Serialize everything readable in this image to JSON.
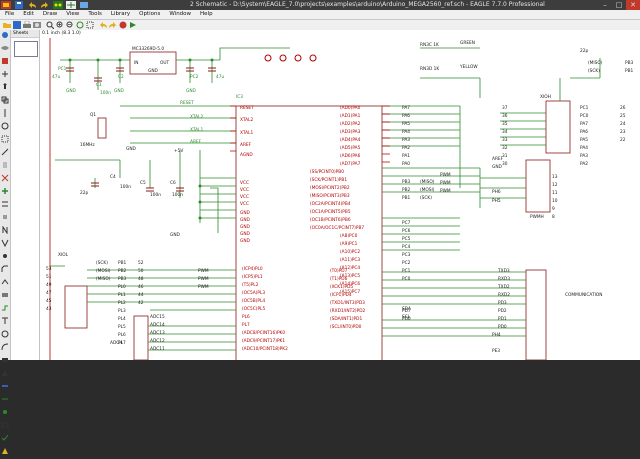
{
  "window": {
    "title": "2 Schematic - D:\\System\\EAGLE_7.0\\projects\\examples\\arduino\\Arduino_MEGA2560_ref.sch - EAGLE 7.7.0 Professional",
    "minimize": "–",
    "maximize": "□",
    "close": "✕"
  },
  "menu": [
    "File",
    "Edit",
    "Draw",
    "View",
    "Tools",
    "Library",
    "Options",
    "Window",
    "Help"
  ],
  "sheets_panel": {
    "label": "Sheets"
  },
  "command": {
    "value": "0.1 inch (8.3 1.0)"
  },
  "schematic": {
    "texts": [
      {
        "t": "MC33269D-5.0",
        "c": "dark"
      },
      {
        "t": "IN",
        "c": "dark"
      },
      {
        "t": "OUT",
        "c": "dark"
      },
      {
        "t": "GND",
        "c": "dark"
      },
      {
        "t": "PC1",
        "c": "green"
      },
      {
        "t": "PC2",
        "c": "green"
      },
      {
        "t": "C1",
        "c": "green"
      },
      {
        "t": "C2",
        "c": "green"
      },
      {
        "t": "47u",
        "c": "green"
      },
      {
        "t": "100n",
        "c": "green"
      },
      {
        "t": "47u",
        "c": "green"
      },
      {
        "t": "GND",
        "c": "green"
      },
      {
        "t": "GND",
        "c": "green"
      },
      {
        "t": "GND",
        "c": "green"
      },
      {
        "t": "RN3C 1K",
        "c": "dark"
      },
      {
        "t": "RN3D 1K",
        "c": "dark"
      },
      {
        "t": "GREEN",
        "c": "dark"
      },
      {
        "t": "YELLOW",
        "c": "dark"
      },
      {
        "t": "22p",
        "c": "dark"
      },
      {
        "t": "(MISO)",
        "c": "dark"
      },
      {
        "t": "(SCK)",
        "c": "dark"
      },
      {
        "t": "PB3",
        "c": "dark"
      },
      {
        "t": "PB1",
        "c": "dark"
      },
      {
        "t": "RESET",
        "c": "green"
      },
      {
        "t": "XTAL2",
        "c": "green"
      },
      {
        "t": "XTAL1",
        "c": "green"
      },
      {
        "t": "AREF",
        "c": "green"
      },
      {
        "t": "IC3",
        "c": "green"
      },
      {
        "t": "RESET",
        "c": "red"
      },
      {
        "t": "XTAL2",
        "c": "red"
      },
      {
        "t": "XTAL1",
        "c": "red"
      },
      {
        "t": "AREF",
        "c": "red"
      },
      {
        "t": "AGND",
        "c": "red"
      },
      {
        "t": "VCC",
        "c": "red"
      },
      {
        "t": "VCC",
        "c": "red"
      },
      {
        "t": "VCC",
        "c": "red"
      },
      {
        "t": "VCC",
        "c": "red"
      },
      {
        "t": "GND",
        "c": "red"
      },
      {
        "t": "GND",
        "c": "red"
      },
      {
        "t": "GND",
        "c": "red"
      },
      {
        "t": "GND",
        "c": "red"
      },
      {
        "t": "GND",
        "c": "red"
      },
      {
        "t": "16MHz",
        "c": "dark"
      },
      {
        "t": "Q1",
        "c": "dark"
      },
      {
        "t": "C4",
        "c": "dark"
      },
      {
        "t": "C5",
        "c": "dark"
      },
      {
        "t": "C6",
        "c": "dark"
      },
      {
        "t": "100n",
        "c": "dark"
      },
      {
        "t": "100n",
        "c": "dark"
      },
      {
        "t": "100n",
        "c": "dark"
      },
      {
        "t": "22p",
        "c": "dark"
      },
      {
        "t": "+5V",
        "c": "dark"
      },
      {
        "t": "GND",
        "c": "dark"
      },
      {
        "t": "GND",
        "c": "dark"
      },
      {
        "t": "(AD0)PA0",
        "c": "red"
      },
      {
        "t": "(AD1)PA1",
        "c": "red"
      },
      {
        "t": "(AD2)PA2",
        "c": "red"
      },
      {
        "t": "(AD3)PA3",
        "c": "red"
      },
      {
        "t": "(AD4)PA4",
        "c": "red"
      },
      {
        "t": "(AD5)PA5",
        "c": "red"
      },
      {
        "t": "(AD6)PA6",
        "c": "red"
      },
      {
        "t": "(AD7)PA7",
        "c": "red"
      },
      {
        "t": "(SS/PCINT0)PB0",
        "c": "red"
      },
      {
        "t": "(SCK/PCINT1)PB1",
        "c": "red"
      },
      {
        "t": "(MOSI/PCINT2)PB2",
        "c": "red"
      },
      {
        "t": "(MISO/PCINT3)PB3",
        "c": "red"
      },
      {
        "t": "(OC2A/PCINT4)PB4",
        "c": "red"
      },
      {
        "t": "(OC1A/PCINT5)PB5",
        "c": "red"
      },
      {
        "t": "(OC1B/PCINT6)PB6",
        "c": "red"
      },
      {
        "t": "(OC0A/OC1C/PCINT7)PB7",
        "c": "red"
      },
      {
        "t": "(A8)PC0",
        "c": "red"
      },
      {
        "t": "(A9)PC1",
        "c": "red"
      },
      {
        "t": "(A10)PC2",
        "c": "red"
      },
      {
        "t": "(A11)PC3",
        "c": "red"
      },
      {
        "t": "(A12)PC4",
        "c": "red"
      },
      {
        "t": "(A13)PC5",
        "c": "red"
      },
      {
        "t": "(A14)PC6",
        "c": "red"
      },
      {
        "t": "(A15)PC7",
        "c": "red"
      },
      {
        "t": "PA7",
        "c": "dark"
      },
      {
        "t": "PA6",
        "c": "dark"
      },
      {
        "t": "PA5",
        "c": "dark"
      },
      {
        "t": "PA4",
        "c": "dark"
      },
      {
        "t": "PA3",
        "c": "dark"
      },
      {
        "t": "PA2",
        "c": "dark"
      },
      {
        "t": "PA1",
        "c": "dark"
      },
      {
        "t": "PA0",
        "c": "dark"
      },
      {
        "t": "PWM",
        "c": "dark"
      },
      {
        "t": "PWM",
        "c": "dark"
      },
      {
        "t": "PWM",
        "c": "dark"
      },
      {
        "t": "(MISO)",
        "c": "dark"
      },
      {
        "t": "(MOSI)",
        "c": "dark"
      },
      {
        "t": "(SCK)",
        "c": "dark"
      },
      {
        "t": "PB3",
        "c": "dark"
      },
      {
        "t": "PB2",
        "c": "dark"
      },
      {
        "t": "PB1",
        "c": "dark"
      },
      {
        "t": "PC7",
        "c": "dark"
      },
      {
        "t": "PC6",
        "c": "dark"
      },
      {
        "t": "PC5",
        "c": "dark"
      },
      {
        "t": "PC4",
        "c": "dark"
      },
      {
        "t": "PC3",
        "c": "dark"
      },
      {
        "t": "PC2",
        "c": "dark"
      },
      {
        "t": "PC1",
        "c": "dark"
      },
      {
        "t": "PC0",
        "c": "dark"
      },
      {
        "t": "AREF",
        "c": "dark"
      },
      {
        "t": "GND",
        "c": "dark"
      },
      {
        "t": "PH6",
        "c": "dark"
      },
      {
        "t": "PH5",
        "c": "dark"
      },
      {
        "t": "XIOH",
        "c": "dark"
      },
      {
        "t": "PWMH",
        "c": "dark"
      },
      {
        "t": "37",
        "c": "dark"
      },
      {
        "t": "36",
        "c": "dark"
      },
      {
        "t": "35",
        "c": "dark"
      },
      {
        "t": "34",
        "c": "dark"
      },
      {
        "t": "33",
        "c": "dark"
      },
      {
        "t": "32",
        "c": "dark"
      },
      {
        "t": "31",
        "c": "dark"
      },
      {
        "t": "30",
        "c": "dark"
      },
      {
        "t": "26",
        "c": "dark"
      },
      {
        "t": "25",
        "c": "dark"
      },
      {
        "t": "24",
        "c": "dark"
      },
      {
        "t": "23",
        "c": "dark"
      },
      {
        "t": "22",
        "c": "dark"
      },
      {
        "t": "PC1",
        "c": "dark"
      },
      {
        "t": "PC0",
        "c": "dark"
      },
      {
        "t": "PA7",
        "c": "dark"
      },
      {
        "t": "PA6",
        "c": "dark"
      },
      {
        "t": "PA5",
        "c": "dark"
      },
      {
        "t": "PA4",
        "c": "dark"
      },
      {
        "t": "PA3",
        "c": "dark"
      },
      {
        "t": "PA2",
        "c": "dark"
      },
      {
        "t": "13",
        "c": "dark"
      },
      {
        "t": "12",
        "c": "dark"
      },
      {
        "t": "11",
        "c": "dark"
      },
      {
        "t": "10",
        "c": "dark"
      },
      {
        "t": "9",
        "c": "dark"
      },
      {
        "t": "8",
        "c": "dark"
      },
      {
        "t": "XIOL",
        "c": "dark"
      },
      {
        "t": "(SCK)",
        "c": "dark"
      },
      {
        "t": "(MOSI)",
        "c": "dark"
      },
      {
        "t": "(MISO)",
        "c": "dark"
      },
      {
        "t": "PB1",
        "c": "dark"
      },
      {
        "t": "PB2",
        "c": "dark"
      },
      {
        "t": "PB3",
        "c": "dark"
      },
      {
        "t": "PL0",
        "c": "dark"
      },
      {
        "t": "PL1",
        "c": "dark"
      },
      {
        "t": "PL2",
        "c": "dark"
      },
      {
        "t": "PL3",
        "c": "dark"
      },
      {
        "t": "PL4",
        "c": "dark"
      },
      {
        "t": "PL5",
        "c": "dark"
      },
      {
        "t": "PL6",
        "c": "dark"
      },
      {
        "t": "PL7",
        "c": "dark"
      },
      {
        "t": "52",
        "c": "dark"
      },
      {
        "t": "50",
        "c": "dark"
      },
      {
        "t": "48",
        "c": "dark"
      },
      {
        "t": "46",
        "c": "dark"
      },
      {
        "t": "44",
        "c": "dark"
      },
      {
        "t": "42",
        "c": "dark"
      },
      {
        "t": "53",
        "c": "dark"
      },
      {
        "t": "51",
        "c": "dark"
      },
      {
        "t": "49",
        "c": "dark"
      },
      {
        "t": "47",
        "c": "dark"
      },
      {
        "t": "45",
        "c": "dark"
      },
      {
        "t": "43",
        "c": "dark"
      },
      {
        "t": "PWM",
        "c": "dark"
      },
      {
        "t": "PWM",
        "c": "dark"
      },
      {
        "t": "PWM",
        "c": "dark"
      },
      {
        "t": "(ICP4)PL0",
        "c": "red"
      },
      {
        "t": "(ICP5)PL1",
        "c": "red"
      },
      {
        "t": "(T5)PL2",
        "c": "red"
      },
      {
        "t": "(OC5A)PL3",
        "c": "red"
      },
      {
        "t": "(OC5B)PL4",
        "c": "red"
      },
      {
        "t": "(OC5C)PL5",
        "c": "red"
      },
      {
        "t": "PL6",
        "c": "red"
      },
      {
        "t": "PL7",
        "c": "red"
      },
      {
        "t": "(ADC8/PCINT16)PK0",
        "c": "red"
      },
      {
        "t": "(ADC9/PCINT17)PK1",
        "c": "red"
      },
      {
        "t": "(ADC10/PCINT18)PK2",
        "c": "red"
      },
      {
        "t": "ADC15",
        "c": "dark"
      },
      {
        "t": "ADC14",
        "c": "dark"
      },
      {
        "t": "ADC13",
        "c": "dark"
      },
      {
        "t": "ADC12",
        "c": "dark"
      },
      {
        "t": "ADC11",
        "c": "dark"
      },
      {
        "t": "ADCH",
        "c": "dark"
      },
      {
        "t": "(T0)PD7",
        "c": "red"
      },
      {
        "t": "(T1)PD6",
        "c": "red"
      },
      {
        "t": "(XCK1)PD5",
        "c": "red"
      },
      {
        "t": "(ICP1)PD4",
        "c": "red"
      },
      {
        "t": "(TXD1/INT3)PD3",
        "c": "red"
      },
      {
        "t": "(RXD1/INT2)PD2",
        "c": "red"
      },
      {
        "t": "(SDA/INT1)PD1",
        "c": "red"
      },
      {
        "t": "(SCL/INT0)PD0",
        "c": "red"
      },
      {
        "t": "PD7",
        "c": "dark"
      },
      {
        "t": "PD0",
        "c": "dark"
      },
      {
        "t": "SDA",
        "c": "dark"
      },
      {
        "t": "SCL",
        "c": "dark"
      },
      {
        "t": "TXD3",
        "c": "dark"
      },
      {
        "t": "RXD3",
        "c": "dark"
      },
      {
        "t": "TXD2",
        "c": "dark"
      },
      {
        "t": "RXD2",
        "c": "dark"
      },
      {
        "t": "PD3",
        "c": "dark"
      },
      {
        "t": "PD2",
        "c": "dark"
      },
      {
        "t": "PD1",
        "c": "dark"
      },
      {
        "t": "PD0",
        "c": "dark"
      },
      {
        "t": "PH4",
        "c": "dark"
      },
      {
        "t": "PE3",
        "c": "dark"
      },
      {
        "t": "COMMUNICATION",
        "c": "dark"
      }
    ]
  }
}
